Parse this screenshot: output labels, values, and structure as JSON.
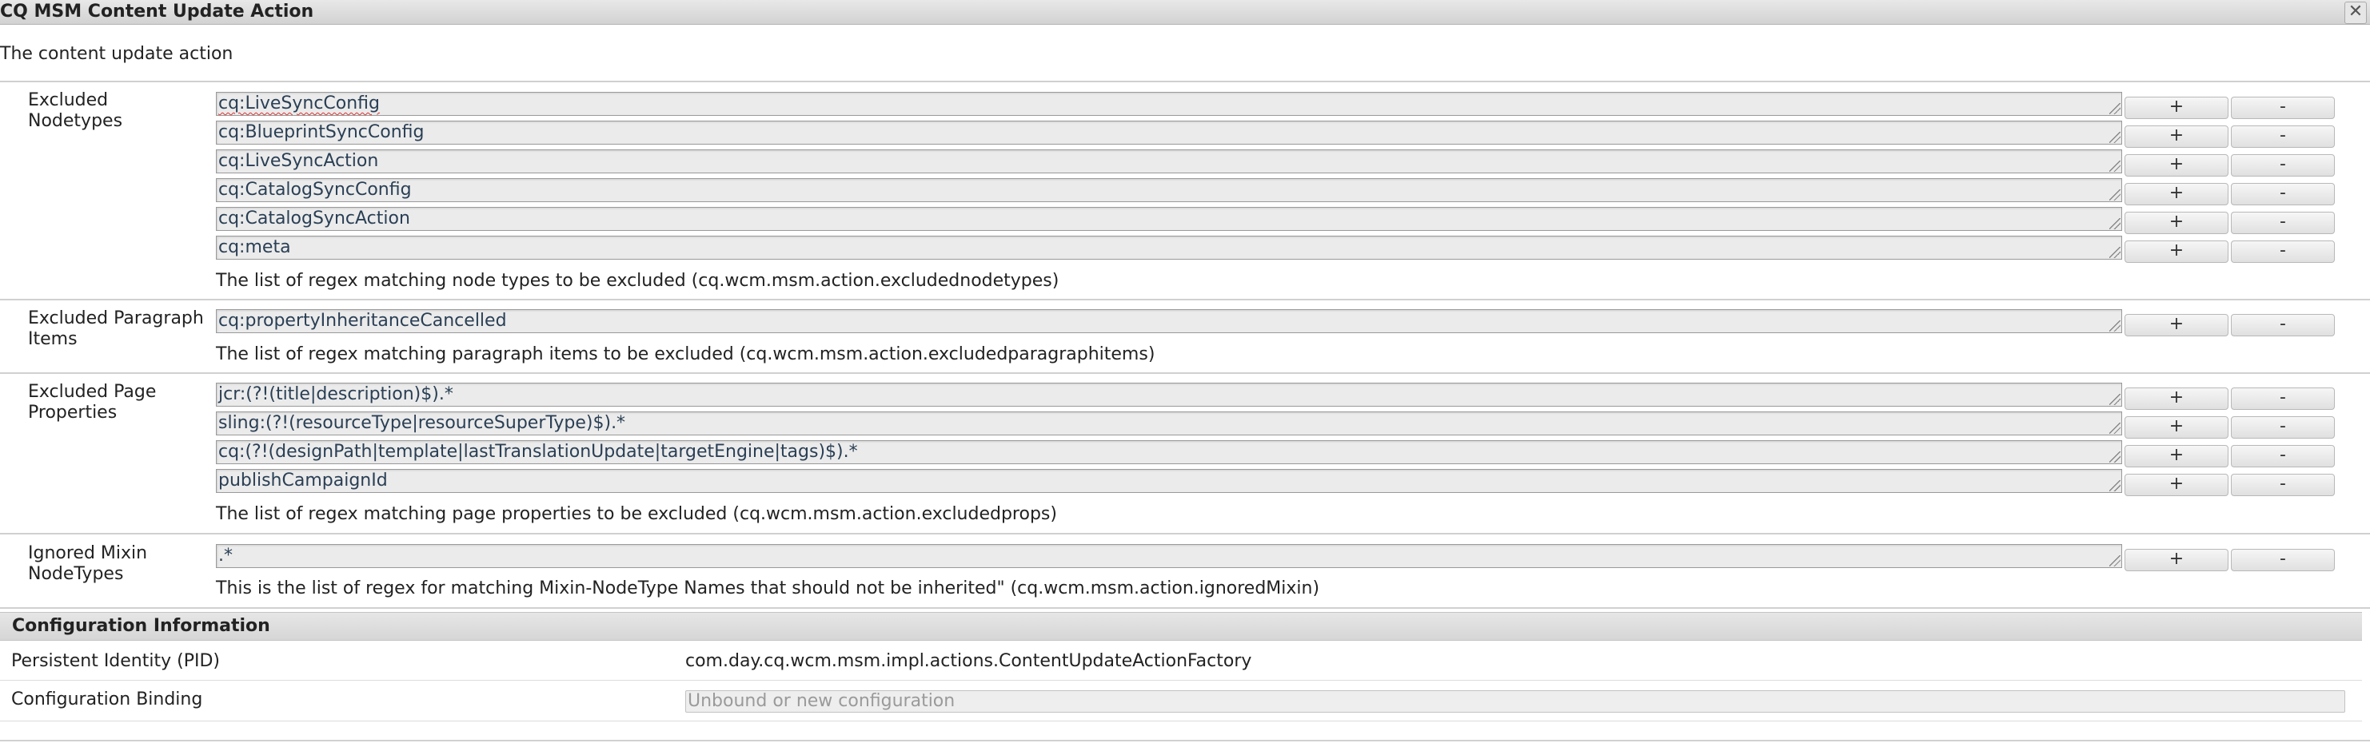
{
  "window": {
    "title": "CQ MSM Content Update Action",
    "close_glyph": "✕",
    "description": "The content update action"
  },
  "sections": {
    "excluded_nodetypes": {
      "label": "Excluded Nodetypes",
      "values": [
        "cq:LiveSyncConfig",
        "cq:BlueprintSyncConfig",
        "cq:LiveSyncAction",
        "cq:CatalogSyncConfig",
        "cq:CatalogSyncAction",
        "cq:meta"
      ],
      "help": "The list of regex matching node types to be excluded (cq.wcm.msm.action.excludednodetypes)"
    },
    "excluded_paragraph_items": {
      "label": "Excluded Paragraph Items",
      "values": [
        "cq:propertyInheritanceCancelled"
      ],
      "help": "The list of regex matching paragraph items to be excluded (cq.wcm.msm.action.excludedparagraphitems)"
    },
    "excluded_page_properties": {
      "label": "Excluded Page Properties",
      "values": [
        "jcr:(?!(title|description)$).*",
        "sling:(?!(resourceType|resourceSuperType)$).*",
        "cq:(?!(designPath|template|lastTranslationUpdate|targetEngine|tags)$).*",
        "publishCampaignId"
      ],
      "help": "The list of regex matching page properties to be excluded (cq.wcm.msm.action.excludedprops)"
    },
    "ignored_mixin_nodetypes": {
      "label": "Ignored Mixin NodeTypes",
      "values": [
        ".*"
      ],
      "help": "This is the list of regex for matching Mixin-NodeType Names that should not be inherited\" (cq.wcm.msm.action.ignoredMixin)"
    }
  },
  "buttons": {
    "add_label": "+",
    "remove_label": "-"
  },
  "config_info": {
    "header": "Configuration Information",
    "pid_label": "Persistent Identity (PID)",
    "pid_value": "com.day.cq.wcm.msm.impl.actions.ContentUpdateActionFactory",
    "binding_label": "Configuration Binding",
    "binding_placeholder": "Unbound or new configuration"
  }
}
